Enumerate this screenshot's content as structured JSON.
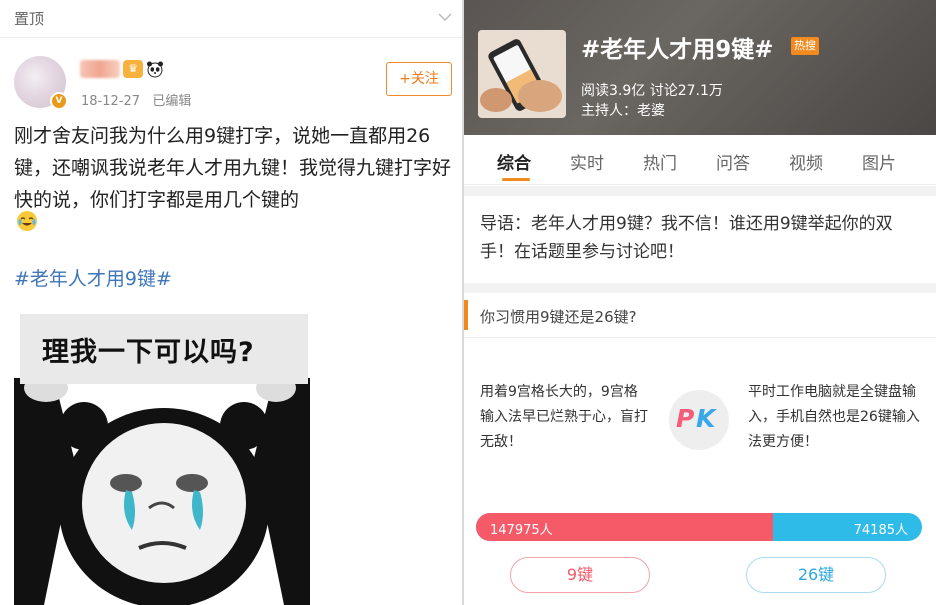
{
  "post": {
    "pin_label": "置顶",
    "timestamp": "18-12-27",
    "edited": "已编辑",
    "follow_label": "+关注",
    "text": "刚才舍友问我为什么用9键打字，说她一直都用26键，还嘲讽我说老年人才用九键！我觉得九键打字好快的说，你们打字都是用几个键的",
    "hashtag": "#老年人才用9键#",
    "meme_caption": "理我一下可以吗?"
  },
  "topic": {
    "title": "#老年人才用9键#",
    "hot_badge": "热搜",
    "stats": "阅读3.9亿  讨论27.1万",
    "host": "主持人：老婆",
    "tabs": [
      "综合",
      "实时",
      "热门",
      "问答",
      "视频",
      "图片"
    ],
    "intro": "导语：老年人才用9键？我不信！谁还用9键举起你的双手！在话题里参与讨论吧！"
  },
  "vote": {
    "question": "你习惯用9键还是26键?",
    "side_a": "用着9宫格长大的，9宫格输入法早已烂熟于心，盲打无敌！",
    "side_b": "平时工作电脑就是全键盘输入，手机自然也是26键输入法更方便！",
    "pk_p": "P",
    "pk_k": "K",
    "left_count": "147975人",
    "right_count": "74185人",
    "left_fraction": 0.6661,
    "left_button": "9键",
    "right_button": "26键",
    "colors": {
      "left": "#f45a67",
      "right": "#2ebbe8",
      "accent": "#f08a1e"
    }
  }
}
